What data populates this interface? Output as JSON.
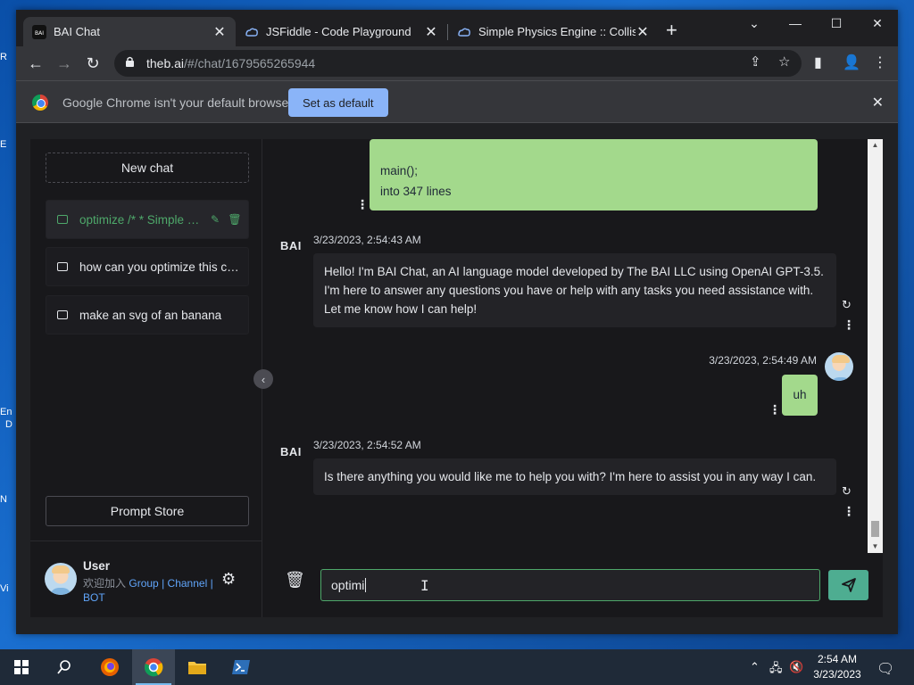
{
  "desktop": {
    "fragments": [
      "R",
      "E",
      "En",
      "D",
      "N",
      "Vi"
    ]
  },
  "browser": {
    "tabs": [
      {
        "title": "BAI Chat",
        "active": true
      },
      {
        "title": "JSFiddle - Code Playground",
        "active": false
      },
      {
        "title": "Simple Physics Engine :: Collision",
        "active": false
      }
    ],
    "url_host": "theb.ai",
    "url_path": "/#/chat/1679565265944",
    "infobar": {
      "message": "Google Chrome isn't your default browser",
      "button": "Set as default"
    }
  },
  "sidebar": {
    "new_chat": "New chat",
    "chats": [
      {
        "label": "optimize /* * Simple Physics Engine",
        "active": true
      },
      {
        "label": "how can you optimize this code",
        "active": false
      },
      {
        "label": "make an svg of an banana",
        "active": false
      }
    ],
    "prompt_store": "Prompt Store",
    "user": {
      "name": "User",
      "sub_prefix": "欢迎加入",
      "link_group": "Group",
      "sep": "|",
      "link_channel": "Channel",
      "link_bot": "BOT"
    }
  },
  "messages": [
    {
      "role": "user",
      "lines": [
        "main();",
        "into 347 lines"
      ]
    },
    {
      "role": "ai",
      "time": "3/23/2023, 2:54:43 AM",
      "text": "Hello! I'm BAI Chat, an AI language model developed by The BAI LLC using OpenAI GPT-3.5. I'm here to answer any questions you have or help with any tasks you need assistance with. Let me know how I can help!"
    },
    {
      "role": "user",
      "time": "3/23/2023, 2:54:49 AM",
      "text": "uh"
    },
    {
      "role": "ai",
      "time": "3/23/2023, 2:54:52 AM",
      "text": "Is there anything you would like me to help you with? I'm here to assist you in any way I can."
    }
  ],
  "ai_logo": "BAI",
  "composer": {
    "value": "optimi"
  },
  "taskbar": {
    "time": "2:54 AM",
    "date": "3/23/2023"
  },
  "colors": {
    "accent_green": "#4ea86a",
    "user_bubble": "#a3d98c",
    "send_button": "#4ead91",
    "chrome_blue": "#8ab4f8"
  }
}
